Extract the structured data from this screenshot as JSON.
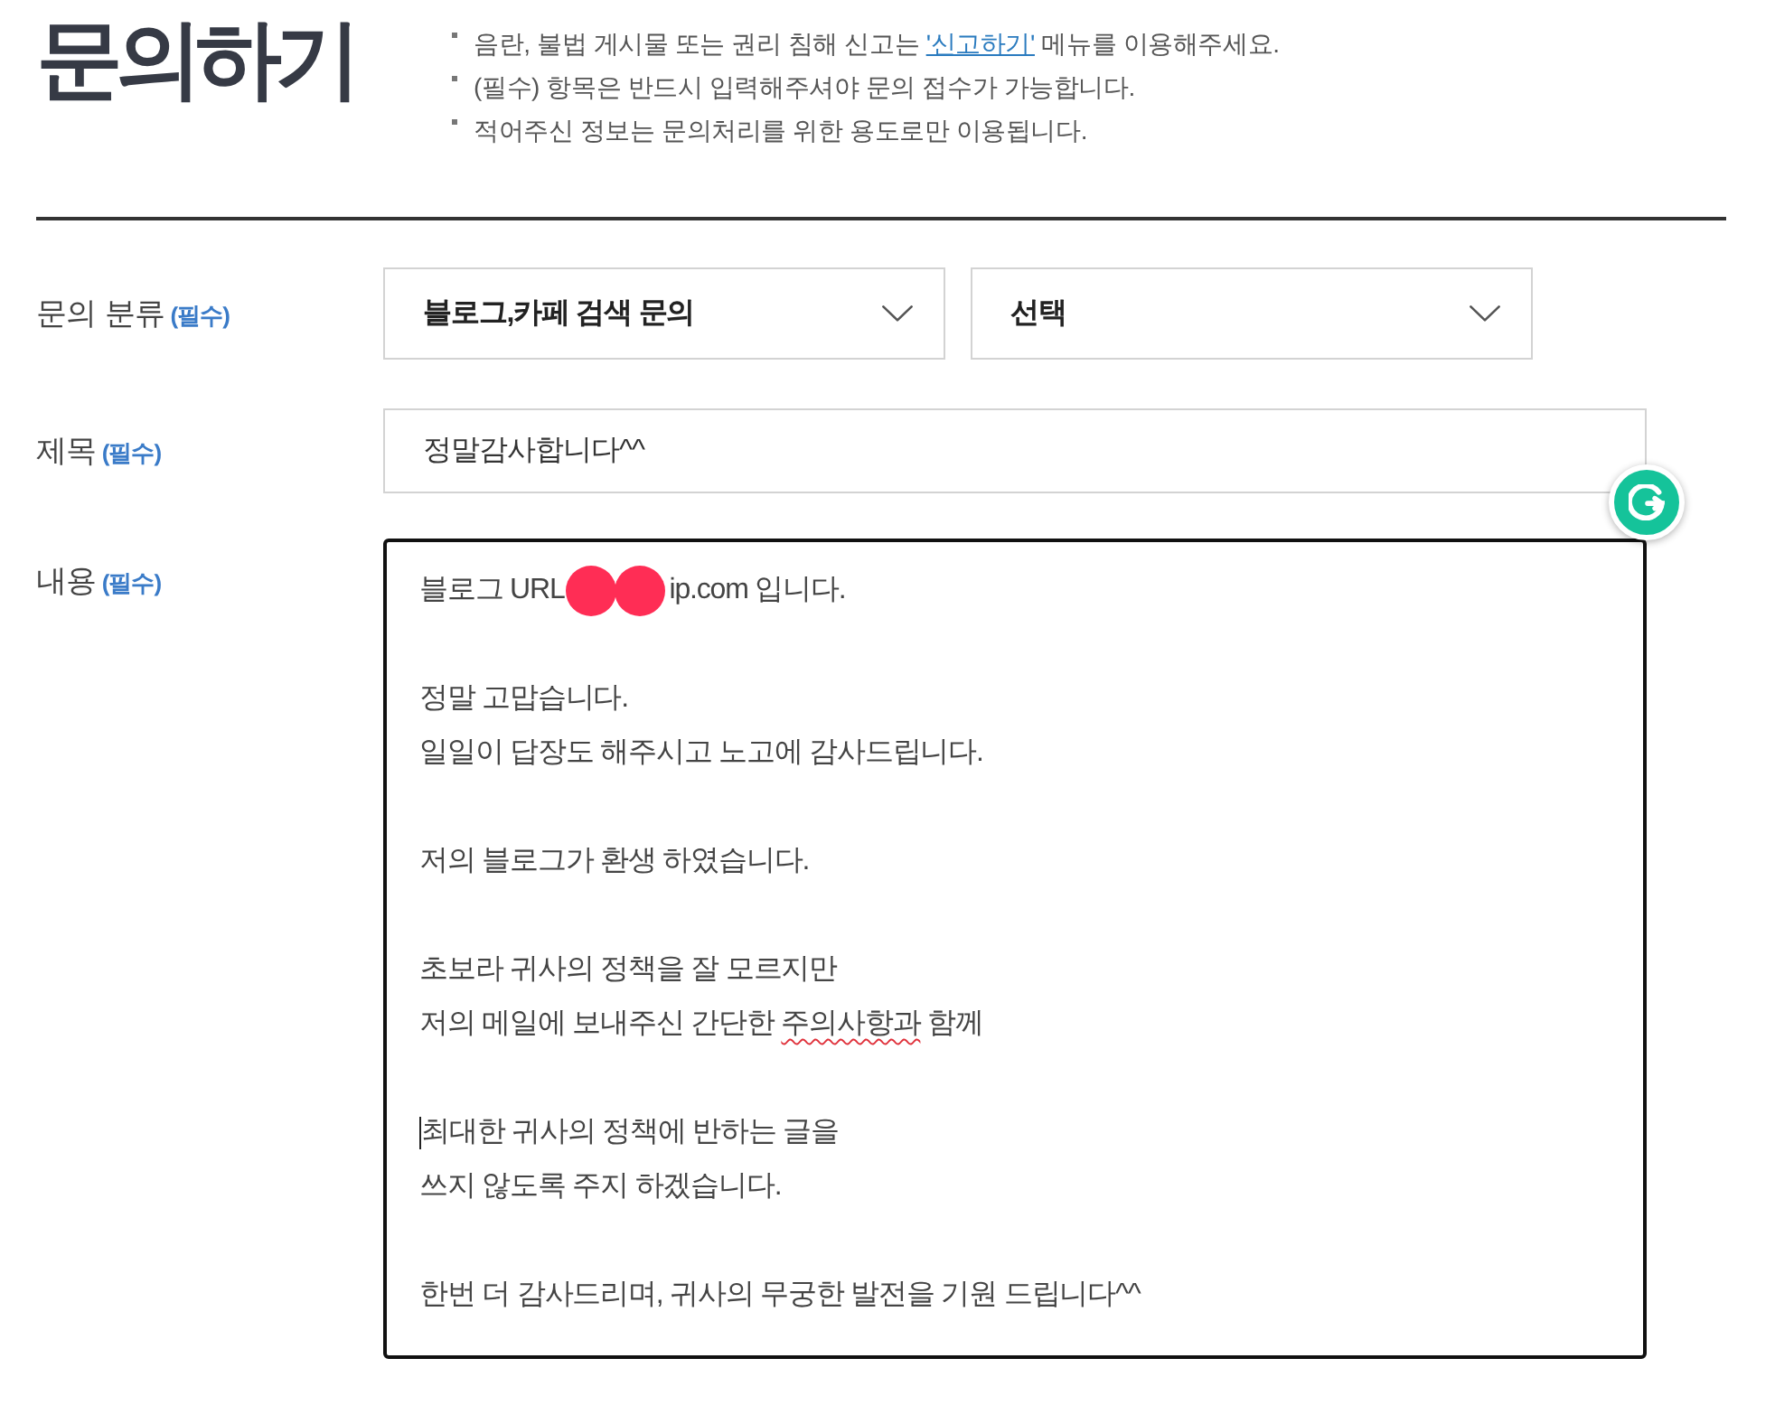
{
  "page": {
    "title": "문의하기",
    "notices": [
      {
        "parts": [
          {
            "kind": "text",
            "text": "음란, 불법 게시물 또는 권리 침해 신고는 "
          },
          {
            "kind": "link",
            "text": "'신고하기'"
          },
          {
            "kind": "text",
            "text": " 메뉴를 이용해주세요."
          }
        ]
      },
      {
        "parts": [
          {
            "kind": "text",
            "text": "(필수) 항목은 반드시 입력해주셔야 문의 접수가 가능합니다."
          }
        ]
      },
      {
        "parts": [
          {
            "kind": "text",
            "text": "적어주신 정보는 문의처리를 위한 용도로만 이용됩니다."
          }
        ]
      }
    ]
  },
  "form": {
    "rows": [
      {
        "kind": "selects",
        "label": "문의 분류",
        "required": "(필수)",
        "selects": [
          {
            "value": "블로그,카페 검색 문의"
          },
          {
            "value": "선택"
          }
        ]
      },
      {
        "kind": "input",
        "label": "제목",
        "required": "(필수)",
        "value": "정말감사합니다^^"
      },
      {
        "kind": "textarea",
        "label": "내용",
        "required": "(필수)",
        "focused": true,
        "paragraphs": [
          {
            "lines": [
              {
                "caret": false,
                "parts": [
                  {
                    "kind": "text",
                    "text": "블로그 URL"
                  },
                  {
                    "kind": "redaction"
                  },
                  {
                    "kind": "text",
                    "text": "ip.com 입니다."
                  }
                ]
              }
            ]
          },
          {
            "lines": [
              {
                "caret": false,
                "parts": [
                  {
                    "kind": "text",
                    "text": "정말 고맙습니다."
                  }
                ]
              },
              {
                "caret": false,
                "parts": [
                  {
                    "kind": "text",
                    "text": "일일이 답장도 해주시고 노고에 감사드립니다."
                  }
                ]
              }
            ]
          },
          {
            "lines": [
              {
                "caret": false,
                "parts": [
                  {
                    "kind": "text",
                    "text": "저의 블로그가 환생 하였습니다."
                  }
                ]
              }
            ]
          },
          {
            "lines": [
              {
                "caret": false,
                "parts": [
                  {
                    "kind": "text",
                    "text": "초보라 귀사의 정책을 잘 모르지만"
                  }
                ]
              },
              {
                "caret": false,
                "parts": [
                  {
                    "kind": "text",
                    "text": "저의 메일에 보내주신 간단한 "
                  },
                  {
                    "kind": "misspelled",
                    "text": "주의사항과"
                  },
                  {
                    "kind": "text",
                    "text": " 함께"
                  }
                ]
              }
            ]
          },
          {
            "lines": [
              {
                "caret": true,
                "parts": [
                  {
                    "kind": "text",
                    "text": "최대한 귀사의 정책에 반하는 글을"
                  }
                ]
              },
              {
                "caret": false,
                "parts": [
                  {
                    "kind": "text",
                    "text": "쓰지 않도록 주지 하겠습니다."
                  }
                ]
              }
            ]
          },
          {
            "lines": [
              {
                "caret": false,
                "parts": [
                  {
                    "kind": "text",
                    "text": "한번 더 감사드리며, 귀사의 무궁한 발전을 기원 드립니다^^"
                  }
                ]
              }
            ]
          }
        ]
      }
    ]
  }
}
